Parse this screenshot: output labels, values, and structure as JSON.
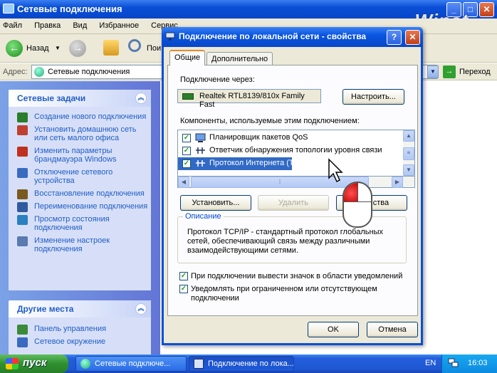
{
  "bg_window": {
    "title": "Сетевые подключения",
    "menu": [
      "Файл",
      "Правка",
      "Вид",
      "Избранное",
      "Сервис"
    ],
    "back_label": "Назад",
    "search_partial": "Пои",
    "address_label": "Адрес:",
    "address_value": "Сетевые подключения",
    "go_label": "Переход",
    "logo": "Winet"
  },
  "sidebar": {
    "network_tasks": {
      "title": "Сетевые задачи",
      "items": [
        {
          "label": "Создание нового подключения",
          "color": "#2a7d2a"
        },
        {
          "label": "Установить домашнюю сеть или сеть малого офиса",
          "color": "#c04030"
        },
        {
          "label": "Изменить параметры брандмауэра Windows",
          "color": "#c03020"
        },
        {
          "label": "Отключение сетевого устройства",
          "color": "#3a6ac0"
        },
        {
          "label": "Восстановление подключения",
          "color": "#7a5a20"
        },
        {
          "label": "Переименование подключения",
          "color": "#305aa0"
        },
        {
          "label": "Просмотр состояния подключения",
          "color": "#2a80c0"
        },
        {
          "label": "Изменение настроек подключения",
          "color": "#5a7ab0"
        }
      ]
    },
    "other_places": {
      "title": "Другие места",
      "items": [
        {
          "label": "Панель управления",
          "color": "#3a8a3a"
        },
        {
          "label": "Сетевое окружение",
          "color": "#3a6ac0"
        }
      ]
    }
  },
  "dialog": {
    "title": "Подключение по локальной сети - свойства",
    "help": "?",
    "close": "✕",
    "tabs": [
      "Общие",
      "Дополнительно"
    ],
    "connect_using_label": "Подключение через:",
    "adapter": "Realtek RTL8139/810x Family Fast",
    "configure_button": "Настроить...",
    "components_label": "Компоненты, используемые этим подключением:",
    "components": [
      {
        "label": "Планировщик пакетов QoS",
        "checked": true
      },
      {
        "label": "Ответчик обнаружения топологии уровня связи",
        "checked": true
      },
      {
        "label": "Протокол Интернета (TCP/IP)",
        "checked": true
      }
    ],
    "install_button": "Установить...",
    "uninstall_button": "Удалить",
    "properties_button": "Свойства",
    "description_legend": "Описание",
    "description_text": "Протокол TCP/IP - стандартный протокол глобальных сетей, обеспечивающий связь между различными взаимодействующими сетями.",
    "show_icon_label": "При подключении вывести значок в области уведомлений",
    "notify_label": "Уведомлять при ограниченном или отсутствующем подключении",
    "ok_button": "OK",
    "cancel_button": "Отмена"
  },
  "taskbar": {
    "start_label": "пуск",
    "tasks": [
      "Сетевые подключе...",
      "Подключение по лока..."
    ],
    "lang": "EN",
    "clock": "16:03"
  },
  "colors": {
    "accent": "#0a4fd6",
    "selection": "#316ac5",
    "start": "#2f902f"
  }
}
